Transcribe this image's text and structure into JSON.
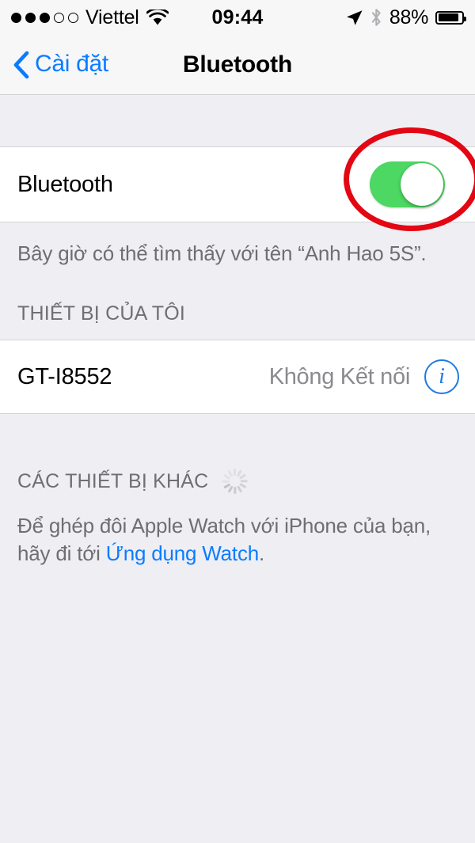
{
  "status_bar": {
    "signal_dots_filled": 3,
    "signal_dots_total": 5,
    "carrier": "Viettel",
    "wifi_icon": "wifi-icon",
    "time": "09:44",
    "location_icon": "location-arrow-icon",
    "bluetooth_icon": "bluetooth-icon",
    "battery_percent": "88%",
    "battery_level": 88
  },
  "nav_bar": {
    "back_icon": "chevron-left-icon",
    "back_label": "Cài đặt",
    "title": "Bluetooth"
  },
  "bluetooth": {
    "label": "Bluetooth",
    "toggle_on": true,
    "toggle_color": "#4CD862",
    "discoverable_note": "Bây giờ có thể tìm thấy với tên “Anh Hao 5S”."
  },
  "my_devices": {
    "header": "THIẾT BỊ CỦA TÔI",
    "devices": [
      {
        "name": "GT-I8552",
        "status": "Không Kết nối",
        "info_icon": "info-circle-icon"
      }
    ]
  },
  "other_devices": {
    "header": "CÁC THIẾT BỊ KHÁC",
    "spinner_icon": "loading-spinner-icon",
    "footer_prefix": "Để ghép đôi Apple Watch với iPhone của bạn, hãy đi tới ",
    "footer_link": "Ứng dụng Watch",
    "footer_suffix": "."
  },
  "annotation": {
    "shape": "ellipse",
    "color": "#E30613",
    "target": "bluetooth-toggle"
  },
  "colors": {
    "accent_blue": "#0A7CFF",
    "group_background": "#EFEEF3",
    "cell_background": "#FFFFFF",
    "secondary_text": "#8A8A8F"
  }
}
